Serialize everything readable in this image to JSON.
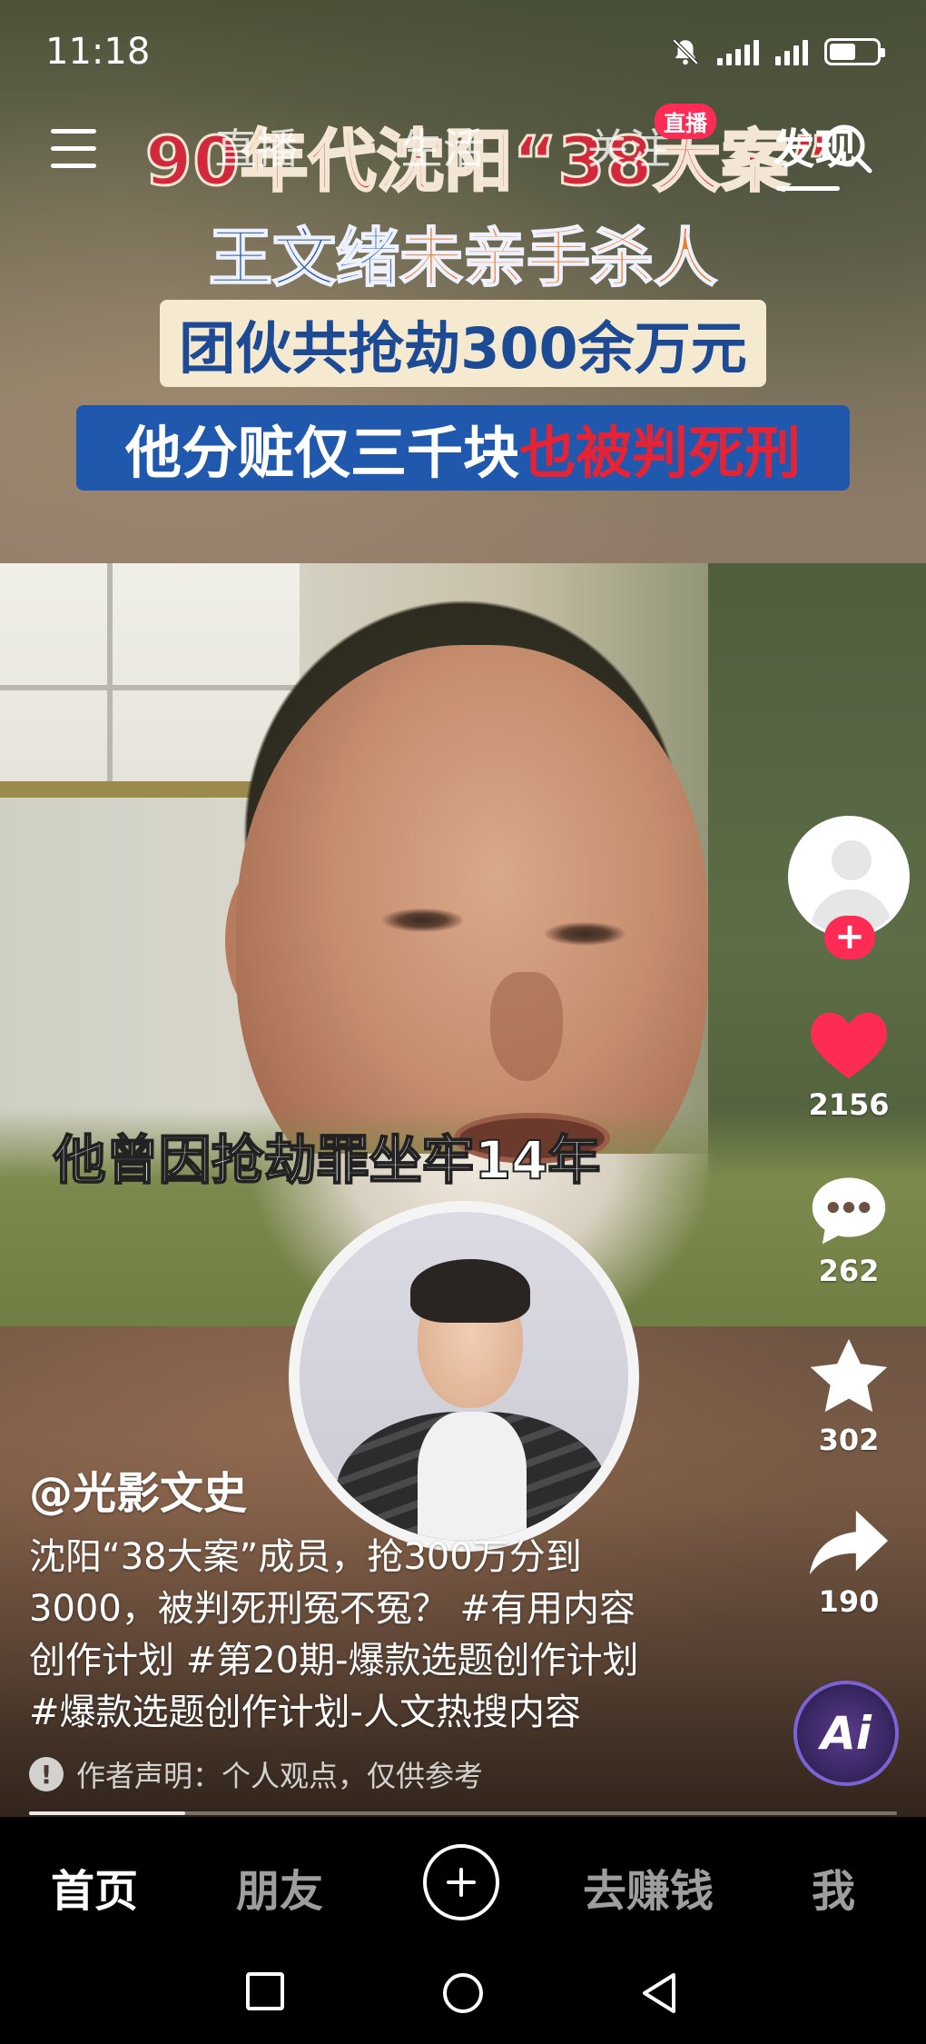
{
  "status_bar": {
    "time": "11:18",
    "battery_percent": 55
  },
  "top_nav": {
    "tabs": [
      {
        "label": "直播",
        "badge": ""
      },
      {
        "label": "生活",
        "badge": ""
      },
      {
        "label": "关注",
        "badge": "直播"
      },
      {
        "label": "发现",
        "badge": ""
      }
    ],
    "active_tab": "发现"
  },
  "video": {
    "headline_1": "90年代沈阳“38大案”",
    "headline_2a": "王文绪",
    "headline_2b": "未亲手杀人",
    "caption_box": "团伙共抢劫300余万元",
    "caption_box2a": "他分赃仅三千块",
    "caption_box2b": "也被判死刑",
    "subtitle": "他曾因抢劫罪坐牢14年"
  },
  "rail": {
    "follow_label": "+",
    "like_count": "2156",
    "comment_count": "262",
    "favorite_count": "302",
    "share_count": "190",
    "ai_label": "Ai"
  },
  "post": {
    "author": "@光影文史",
    "desc_line1": "沈阳“38大案”成员，抢300万分到",
    "desc_line2": "3000，被判死刑冤不冤？ #有用内容",
    "desc_line3": "创作计划 #第20期-爆款选题创作计划",
    "desc_line4": "#爆款选题创作计划-人文热搜内容",
    "notice": "作者声明：个人观点，仅供参考",
    "progress": 0.18
  },
  "tabbar": {
    "home": "首页",
    "friends": "朋友",
    "earn": "去赚钱",
    "me": "我"
  },
  "colors": {
    "accent": "#fe2c55",
    "like": "#fe2c55"
  }
}
